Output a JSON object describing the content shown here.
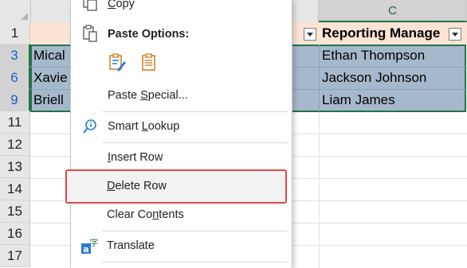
{
  "sheet": {
    "column_headers": [
      "C"
    ],
    "row_numbers": [
      "1",
      "3",
      "6",
      "9",
      "11",
      "12",
      "13",
      "14",
      "15",
      "16",
      "17"
    ],
    "header_cell": "Reporting Manage",
    "left_cells": [
      "Mical",
      "Xavie",
      "Briell"
    ],
    "managers": [
      "Ethan Thompson",
      "Jackson Johnson",
      "Liam James"
    ],
    "colors": {
      "selection": "#a6b8cc",
      "header_fill": "#fbe4d5",
      "selection_border": "#217346",
      "highlight_box": "#e0474c"
    }
  },
  "menu": {
    "copy": {
      "label": "Copy",
      "mnemonic": "C",
      "rest": "opy",
      "icon": "copy-icon"
    },
    "paste_options": {
      "label": "Paste Options:",
      "icon": "clipboard-icon",
      "sub_icons": [
        "paste-formatting-icon",
        "paste-values-icon"
      ]
    },
    "paste_special": {
      "label": "Paste Special...",
      "pre": "Paste ",
      "mnemonic": "S",
      "rest": "pecial..."
    },
    "smart_lookup": {
      "label": "Smart Lookup",
      "pre": "Smart ",
      "mnemonic": "L",
      "rest": "ookup",
      "icon": "smart-lookup-icon"
    },
    "insert_row": {
      "label": "Insert Row",
      "mnemonic": "I",
      "rest": "nsert Row"
    },
    "delete_row": {
      "label": "Delete Row",
      "mnemonic": "D",
      "rest": "elete Row"
    },
    "clear_contents": {
      "label": "Clear Contents",
      "pre": "Clear Co",
      "mnemonic": "n",
      "rest": "tents"
    },
    "translate": {
      "label": "Translate",
      "icon": "translate-icon"
    }
  }
}
